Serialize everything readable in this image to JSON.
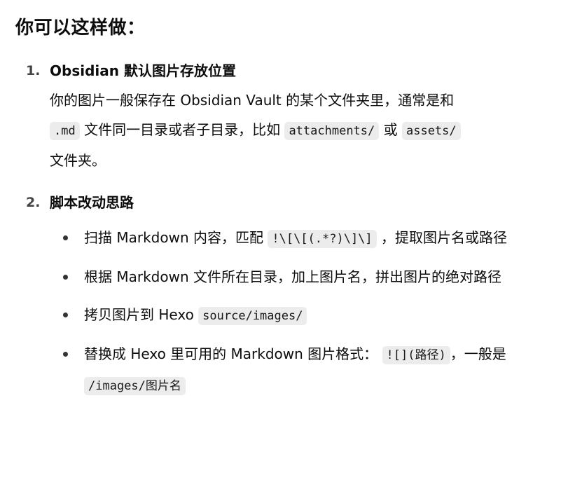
{
  "heading": "你可以这样做：",
  "steps": [
    {
      "number": "1.",
      "title": "Obsidian 默认图片存放位置",
      "body": {
        "t1": "你的图片一般保存在 Obsidian Vault 的某个文件夹里，通常是和",
        "c1": ".md",
        "t2": "文件同一目录或者子目录，比如",
        "c2": "attachments/",
        "t3": "或",
        "c3": "assets/",
        "t4": "文件夹。"
      }
    },
    {
      "number": "2.",
      "title": "脚本改动思路",
      "bullets": [
        {
          "t1": "扫描 Markdown 内容，匹配",
          "c1": "!\\[\\[(.*?)\\]\\]",
          "t2": "，提取图片名或路径"
        },
        {
          "t1": "根据 Markdown 文件所在目录，加上图片名，拼出图片的绝对路径"
        },
        {
          "t1": "拷贝图片到 Hexo",
          "c1": "source/images/"
        },
        {
          "t1": "替换成 Hexo 里可用的 Markdown 图片格式：",
          "c1": "![](路径)",
          "t2": "，一般是",
          "c2": "/images/图片名"
        }
      ]
    }
  ]
}
